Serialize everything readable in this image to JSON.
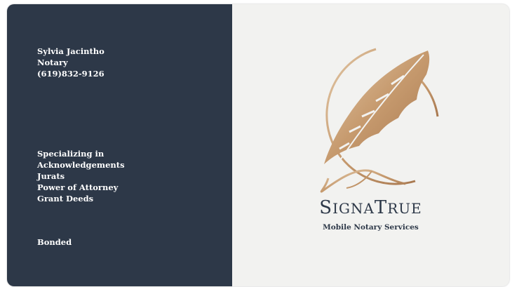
{
  "contact": {
    "name": "Sylvia Jacintho",
    "title": "Notary",
    "phone": "(619)832-9126"
  },
  "services": {
    "heading": "Specializing in",
    "items": [
      "Acknowledgements",
      "Jurats",
      "Power of Attorney",
      "Grant Deeds"
    ]
  },
  "bonded": "Bonded",
  "brand": {
    "name_parts": [
      "S",
      "IGNA",
      "T",
      "RUE"
    ],
    "tagline": "Mobile Notary Services",
    "logo_icon": "quill-feather-icon"
  },
  "colors": {
    "panel": "#2d3848",
    "background": "#f2f2f0",
    "gold": "#c9a27a"
  }
}
